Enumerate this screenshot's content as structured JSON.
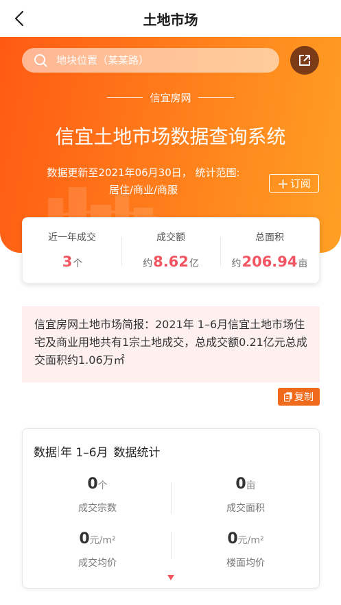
{
  "nav": {
    "title": "土地市场"
  },
  "search": {
    "placeholder": "地块位置（某某路）"
  },
  "brand": {
    "name": "信宜房网"
  },
  "hero": {
    "title": "信宜土地市场数据查询系统",
    "update_line1": "数据更新至2021年06月30日， 统计范围:",
    "update_line2": "居住/商业/商服",
    "subscribe_label": "订阅"
  },
  "summary_stats": [
    {
      "label": "近一年成交",
      "prefix": "",
      "value": "3",
      "unit": "个"
    },
    {
      "label": "成交额",
      "prefix": "约",
      "value": "8.62",
      "unit": "亿"
    },
    {
      "label": "总面积",
      "prefix": "约",
      "value": "206.94",
      "unit": "亩"
    }
  ],
  "report": {
    "text": "信宜房网土地市场简报：2021年 1–6月信宜土地市场住宅及商业用地共有1宗土地成交，总成交额0.21亿元总成交面积约1.06万㎡",
    "copy_label": "复制"
  },
  "data_card": {
    "title_prefix": "数据",
    "title_period": "年 1–6月",
    "title_suffix": "数据统计",
    "cells": [
      {
        "value": "0",
        "unit": "个",
        "label": "成交宗数"
      },
      {
        "value": "0",
        "unit": "亩",
        "label": "成交面积"
      },
      {
        "value": "0",
        "unit": "元/m²",
        "label": "成交均价"
      },
      {
        "value": "0",
        "unit": "元/m²",
        "label": "楼面均价"
      }
    ]
  },
  "colors": {
    "accent": "#ff6a14",
    "highlight": "#f25561",
    "copy_button": "#f06a1c"
  }
}
